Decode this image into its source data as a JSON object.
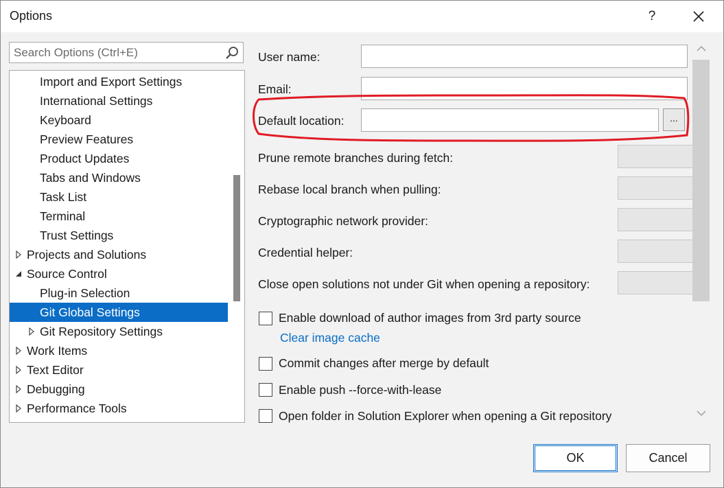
{
  "window": {
    "title": "Options",
    "help": "?",
    "close_icon": "close-icon"
  },
  "search": {
    "placeholder": "Search Options (Ctrl+E)"
  },
  "tree": {
    "items": [
      {
        "label": "Import and Export Settings",
        "level": 1,
        "expander": "none"
      },
      {
        "label": "International Settings",
        "level": 1,
        "expander": "none"
      },
      {
        "label": "Keyboard",
        "level": 1,
        "expander": "none"
      },
      {
        "label": "Preview Features",
        "level": 1,
        "expander": "none"
      },
      {
        "label": "Product Updates",
        "level": 1,
        "expander": "none"
      },
      {
        "label": "Tabs and Windows",
        "level": 1,
        "expander": "none"
      },
      {
        "label": "Task List",
        "level": 1,
        "expander": "none"
      },
      {
        "label": "Terminal",
        "level": 1,
        "expander": "none"
      },
      {
        "label": "Trust Settings",
        "level": 1,
        "expander": "none"
      },
      {
        "label": "Projects and Solutions",
        "level": 0,
        "expander": "collapsed"
      },
      {
        "label": "Source Control",
        "level": 0,
        "expander": "expanded"
      },
      {
        "label": "Plug-in Selection",
        "level": 1,
        "expander": "none"
      },
      {
        "label": "Git Global Settings",
        "level": 1,
        "expander": "none",
        "selected": true
      },
      {
        "label": "Git Repository Settings",
        "level": 1,
        "expander": "collapsed"
      },
      {
        "label": "Work Items",
        "level": 0,
        "expander": "collapsed"
      },
      {
        "label": "Text Editor",
        "level": 0,
        "expander": "collapsed"
      },
      {
        "label": "Debugging",
        "level": 0,
        "expander": "collapsed"
      },
      {
        "label": "Performance Tools",
        "level": 0,
        "expander": "collapsed"
      }
    ]
  },
  "settings": {
    "user_name_label": "User name:",
    "user_name_value": "",
    "email_label": "Email:",
    "email_value": "",
    "default_location_label": "Default location:",
    "default_location_value": "",
    "browse_label": "...",
    "prune_label": "Prune remote branches during fetch:",
    "rebase_label": "Rebase local branch when pulling:",
    "crypto_label": "Cryptographic network provider:",
    "credential_label": "Credential helper:",
    "close_solutions_label": "Close open solutions not under Git when opening a repository:",
    "enable_download_label": "Enable download of author images from 3rd party source",
    "clear_cache_link": "Clear image cache",
    "commit_changes_label": "Commit changes after merge by default",
    "enable_push_label": "Enable push --force-with-lease",
    "open_folder_label": "Open folder in Solution Explorer when opening a Git repository"
  },
  "buttons": {
    "ok": "OK",
    "cancel": "Cancel"
  },
  "colors": {
    "selection": "#0b6dc6",
    "highlight_ellipse": "#e01b24",
    "link": "#0a6ec8"
  }
}
